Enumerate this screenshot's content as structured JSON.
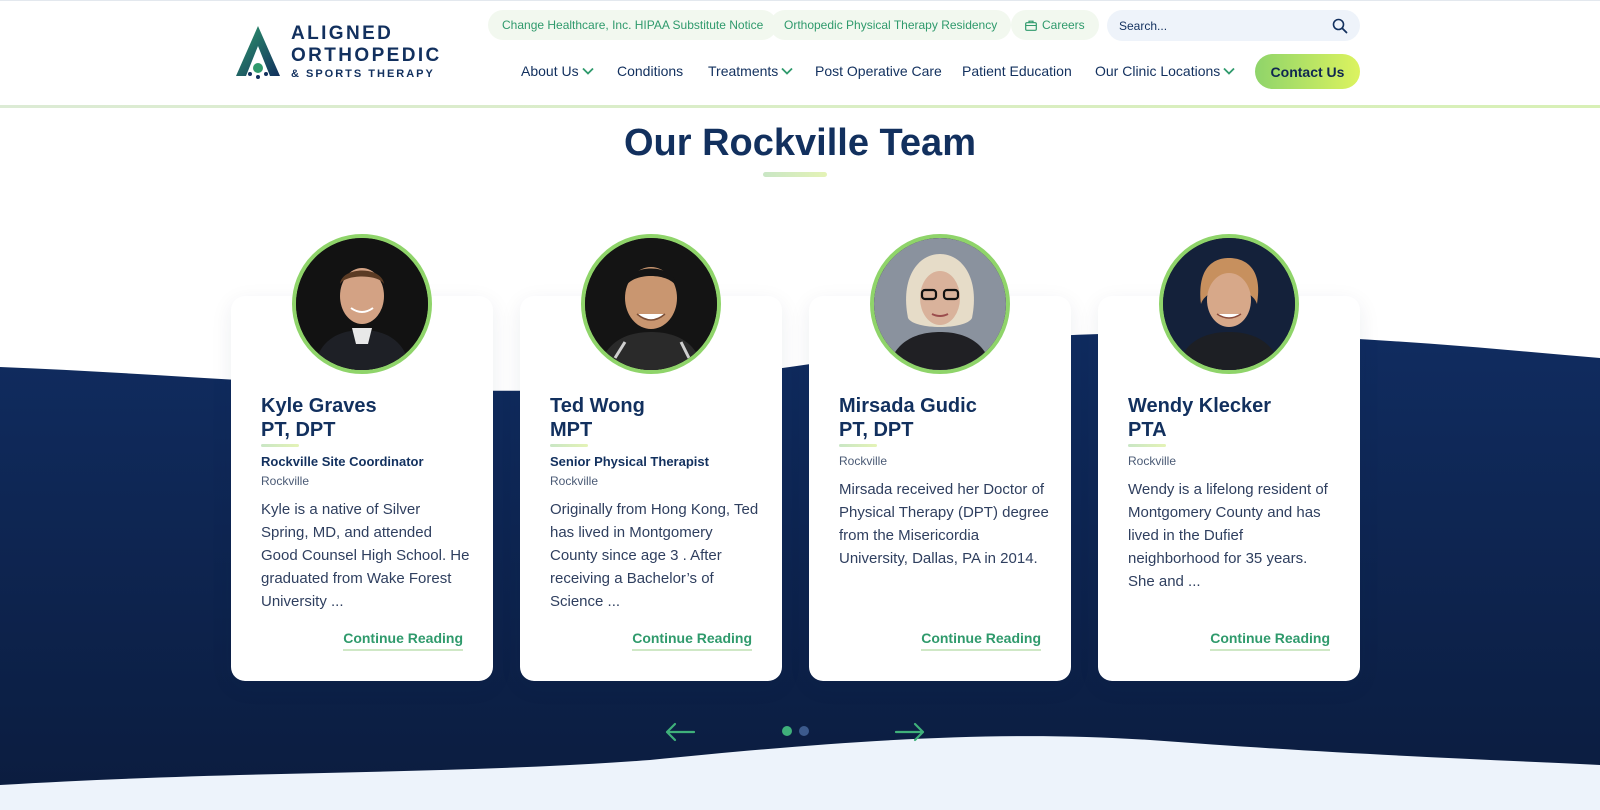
{
  "brand": {
    "line1": "ALIGNED",
    "line2": "ORTHOPEDIC",
    "line3": "& SPORTS THERAPY",
    "logo_icon": "aligned-a-logo"
  },
  "utility": {
    "hipaa": "Change Healthcare, Inc. HIPAA Substitute Notice",
    "residency": "Orthopedic Physical Therapy Residency",
    "careers": "Careers",
    "careers_icon": "briefcase-icon"
  },
  "search": {
    "placeholder": "Search...",
    "icon": "search-icon"
  },
  "nav": {
    "items": [
      {
        "label": "About Us",
        "has_dropdown": true
      },
      {
        "label": "Conditions",
        "has_dropdown": false
      },
      {
        "label": "Treatments",
        "has_dropdown": true
      },
      {
        "label": "Post Operative Care",
        "has_dropdown": false
      },
      {
        "label": "Patient Education",
        "has_dropdown": false
      },
      {
        "label": "Our Clinic Locations",
        "has_dropdown": true
      }
    ],
    "contact": "Contact Us"
  },
  "section": {
    "title": "Our Rockville Team"
  },
  "team": [
    {
      "name": "Kyle Graves",
      "credential": "PT, DPT",
      "role": "Rockville Site Coordinator",
      "location": "Rockville",
      "bio": "Kyle is a native of Silver Spring, MD, and attended Good Counsel High School. He graduated from Wake Forest University ...",
      "link": "Continue Reading"
    },
    {
      "name": "Ted Wong",
      "credential": "MPT",
      "role": "Senior Physical Therapist",
      "location": "Rockville",
      "bio": "Originally from Hong Kong, Ted has lived in Montgomery County since age 3 .  After receiving a Bachelor’s of Science ...",
      "link": "Continue Reading"
    },
    {
      "name": "Mirsada Gudic",
      "credential": "PT, DPT",
      "role": "",
      "location": "Rockville",
      "bio": "Mirsada received her Doctor of Physical Therapy (DPT) degree from the Misericordia University, Dallas, PA in 2014.",
      "link": "Continue Reading"
    },
    {
      "name": "Wendy Klecker",
      "credential": "PTA",
      "role": "",
      "location": "Rockville",
      "bio": "Wendy is a lifelong resident of Montgomery County and has lived in the Dufief neighborhood for 35 years. She and ...",
      "link": "Continue Reading"
    }
  ],
  "slider": {
    "prev_icon": "arrow-left-icon",
    "next_icon": "arrow-right-icon",
    "pages": 2,
    "active_page": 1
  },
  "colors": {
    "navy": "#12305e",
    "green": "#2f9a6c",
    "lime": "#8fd46a",
    "dark_wave": "#0f2650"
  }
}
